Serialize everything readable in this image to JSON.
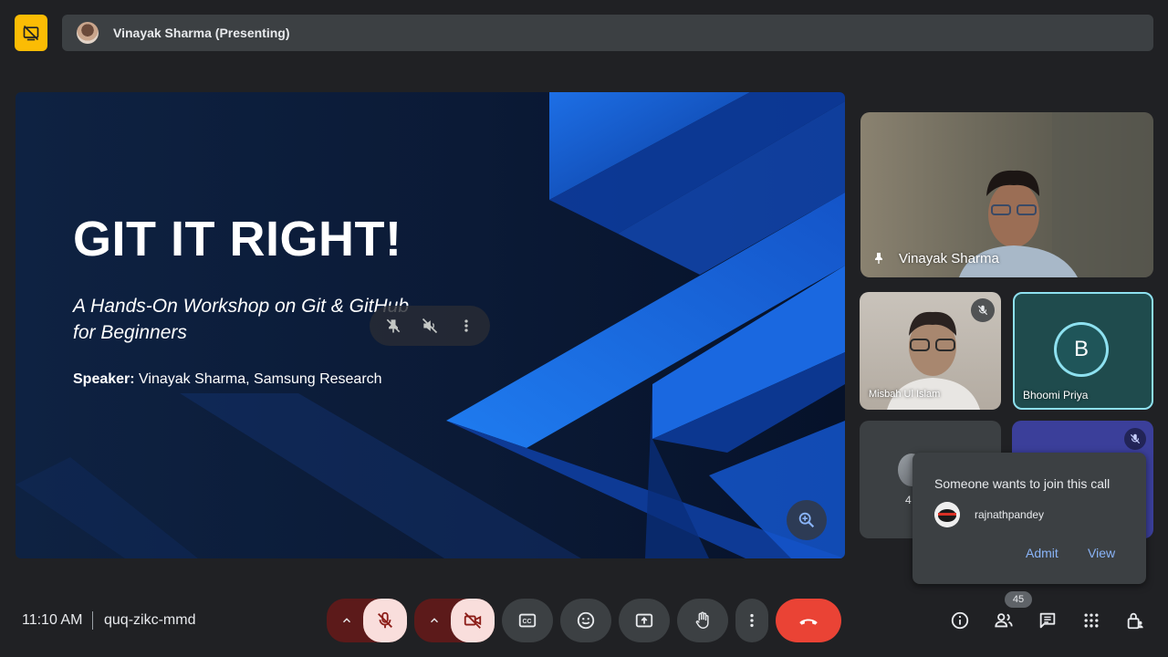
{
  "top": {
    "presenting_label": "Vinayak Sharma (Presenting)",
    "presenting_off_icon": "present-off-icon"
  },
  "slide": {
    "title": "GIT IT RIGHT!",
    "subtitle": "A Hands-On Workshop on Git & GitHub for Beginners",
    "speaker_label": "Speaker:",
    "speaker_value": "Vinayak Sharma, Samsung Research",
    "toolbar_icons": [
      "unpin-icon",
      "volume-off-icon",
      "more-vert-icon"
    ],
    "zoom_icon": "zoom-in-icon"
  },
  "participants": {
    "vinayak": {
      "name": "Vinayak Sharma"
    },
    "misbah": {
      "name": "Misbah Ul Islam",
      "muted": true
    },
    "bhoomi": {
      "name": "Bhoomi Priya",
      "initial": "B"
    },
    "others_count_partial": "4"
  },
  "join_request": {
    "title": "Someone wants to join this call",
    "user": "rajnathpandey",
    "admit_label": "Admit",
    "view_label": "View"
  },
  "bottom": {
    "time": "11:10 AM",
    "meeting_code": "quq-zikc-mmd",
    "people_count": "45",
    "colors": {
      "mic_off_bg": "#f9dedc",
      "pill_dark_red": "#5c1a1a",
      "hangup": "#ea4335",
      "accent_link": "#8ab4f8"
    }
  }
}
